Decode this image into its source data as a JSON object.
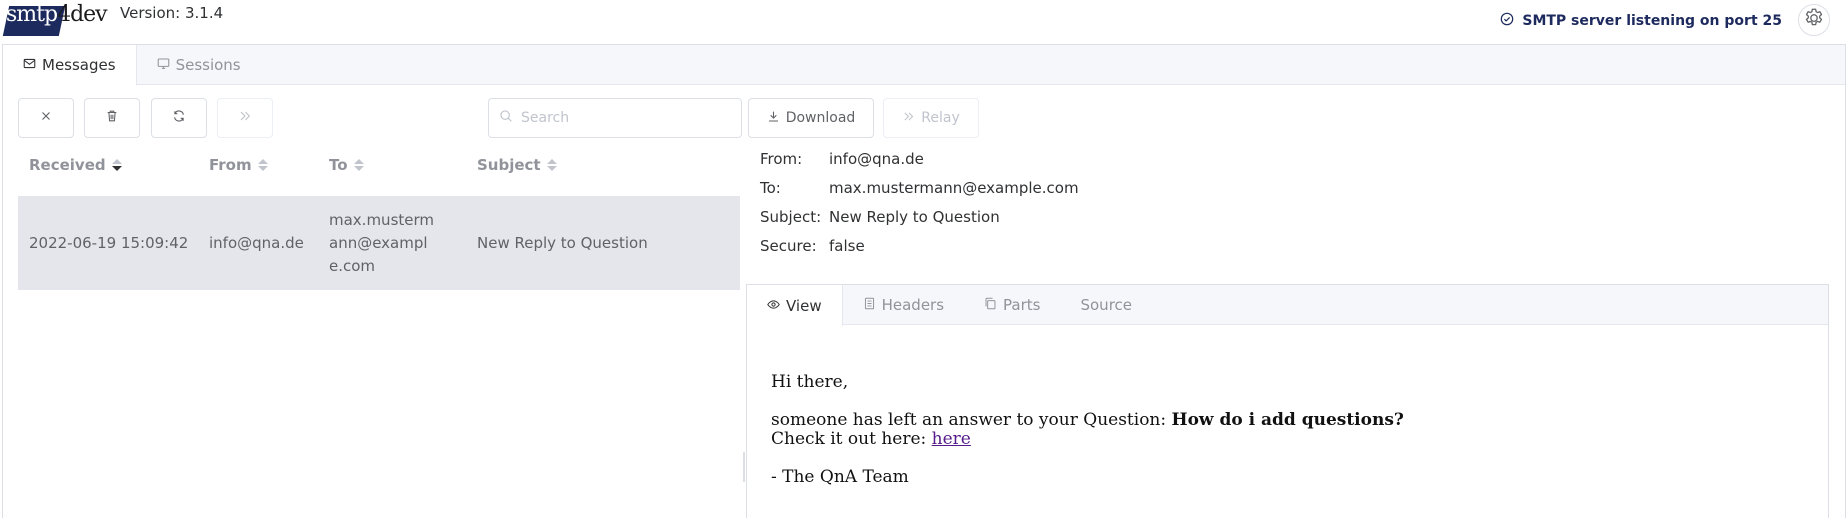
{
  "header": {
    "logo_text": "smtp4dev",
    "logo_main": "smtp",
    "logo_tail": "4dev",
    "version": "Version: 3.1.4",
    "status": "SMTP server listening on port 25"
  },
  "tabs": [
    {
      "label": "Messages",
      "icon": "envelope-icon",
      "active": true
    },
    {
      "label": "Sessions",
      "icon": "monitor-icon",
      "active": false
    }
  ],
  "toolbar": {
    "search_placeholder": "Search",
    "search_value": "",
    "download_label": "Download",
    "relay_label": "Relay",
    "buttons": [
      "close-icon",
      "trash-icon",
      "refresh-icon",
      "double-chevron-right-icon"
    ]
  },
  "table": {
    "columns": [
      "Received",
      "From",
      "To",
      "Subject"
    ],
    "sort": {
      "column": "Received",
      "direction": "descending"
    },
    "rows": [
      {
        "received": "2022-06-19 15:09:42",
        "from": "info@qna.de",
        "to_line1": "max.musterm",
        "to_line2": "ann@exampl",
        "to_line3": "e.com",
        "subject": "New Reply to Question",
        "selected": true
      }
    ]
  },
  "details": {
    "from_label": "From:",
    "from_value": "info@qna.de",
    "to_label": "To:",
    "to_value": "max.mustermann@example.com",
    "subject_label": "Subject:",
    "subject_value": "New Reply to Question",
    "secure_label": "Secure:",
    "secure_value": "false"
  },
  "viewer": {
    "tabs": [
      {
        "label": "View",
        "icon": "eye-icon",
        "active": true
      },
      {
        "label": "Headers",
        "icon": "document-icon",
        "active": false
      },
      {
        "label": "Parts",
        "icon": "copy-icon",
        "active": false
      },
      {
        "label": "Source",
        "icon": "",
        "active": false
      }
    ],
    "greeting": "Hi there,",
    "answer_prefix": "someone has left an answer to your Question:",
    "question_title": "How do i add questions?",
    "check_prefix": "Check it out here:",
    "link_text": "here",
    "signoff": "- The QnA Team"
  },
  "colors": {
    "brand": "#1d2a5e",
    "selected_row": "#e5e6ec",
    "border": "#dcdfe6",
    "muted_text": "#909399",
    "link_visited": "#551a8b"
  }
}
